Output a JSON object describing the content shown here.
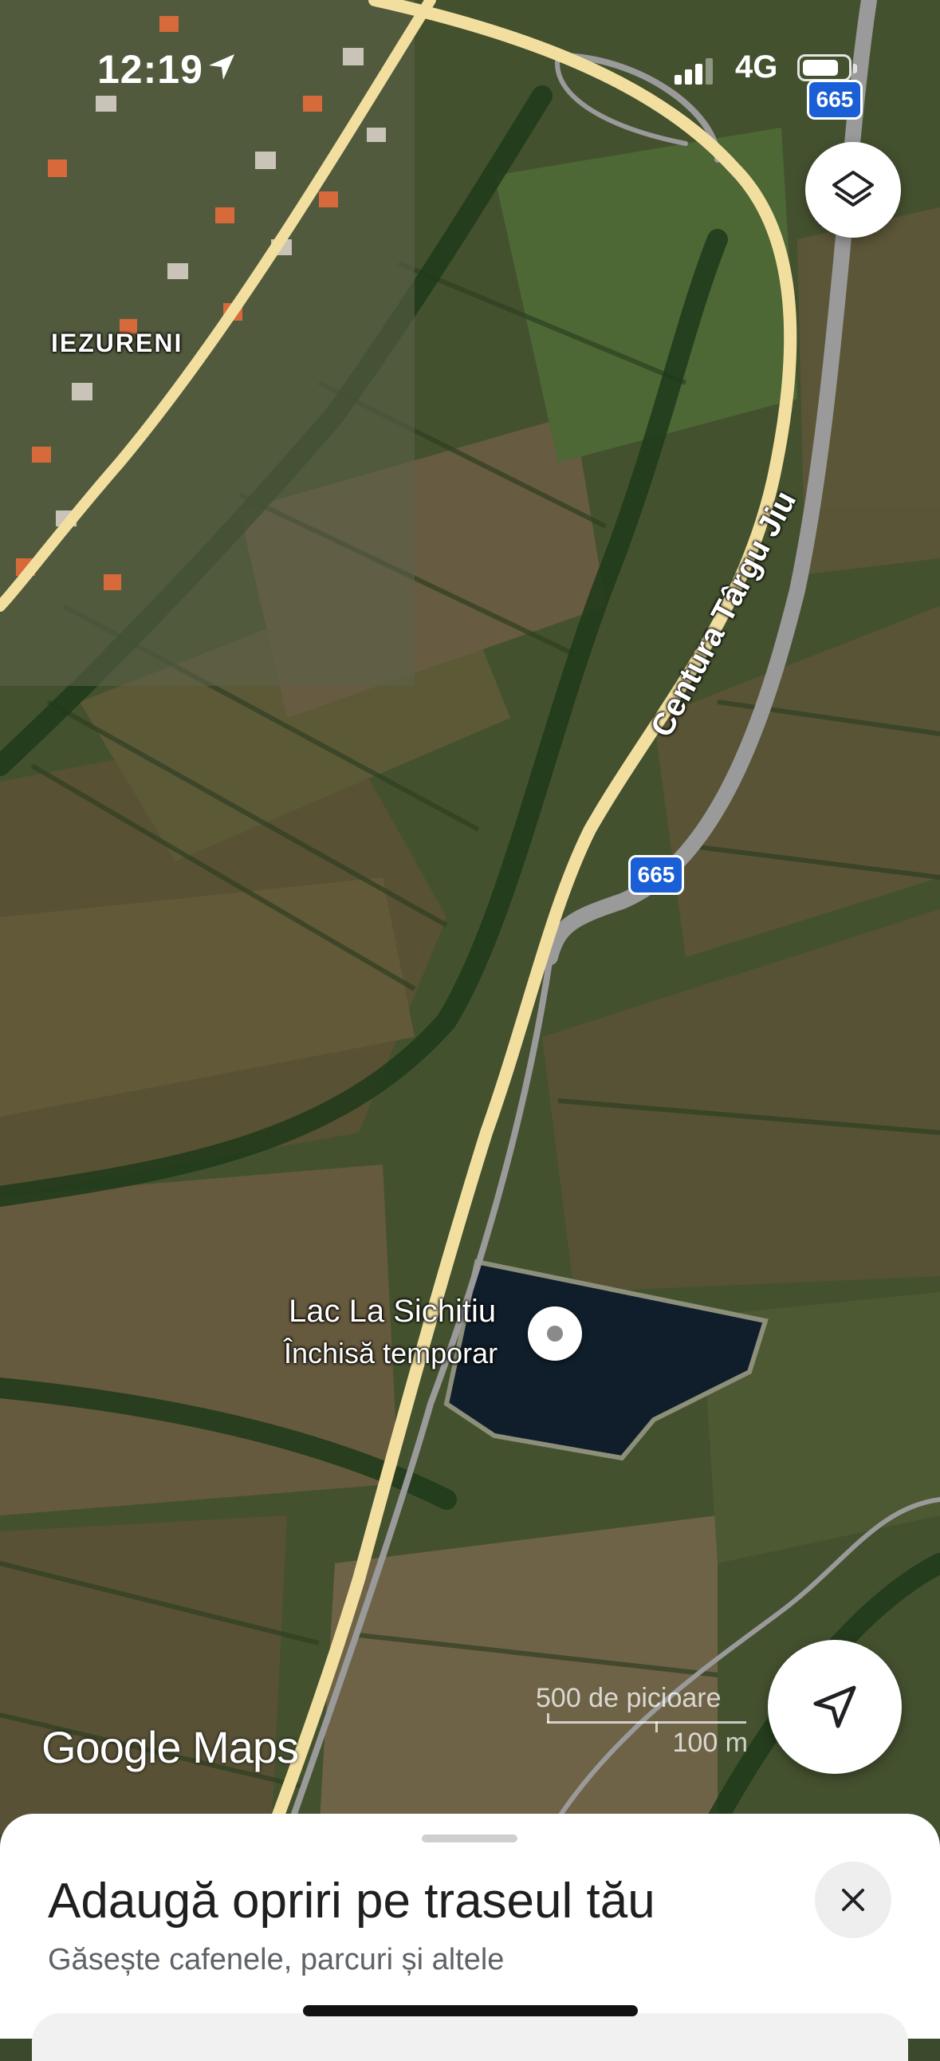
{
  "status_bar": {
    "time": "12:19",
    "network": "4G"
  },
  "map": {
    "type": "satellite",
    "area_label": "IEZURENI",
    "road_label": "Centura Târgu Jiu",
    "route_shields": [
      "665",
      "665"
    ],
    "place": {
      "name": "Lac La Sichitiu",
      "status": "Închisă temporar"
    },
    "branding": "Google Maps",
    "scale": {
      "imperial": "500 de picioare",
      "metric": "100 m"
    }
  },
  "controls": {
    "layers_icon": "layers-icon",
    "navigate_icon": "navigation-arrow-icon",
    "close_icon": "close-icon"
  },
  "sheet": {
    "title": "Adaugă opriri pe traseul tău",
    "subtitle": "Găsește cafenele, parcuri și altele"
  },
  "colors": {
    "road": "#f2dfa0",
    "route_shield": "#1a5fd6",
    "sheet_bg": "#ffffff",
    "water": "#0f1e2a"
  }
}
